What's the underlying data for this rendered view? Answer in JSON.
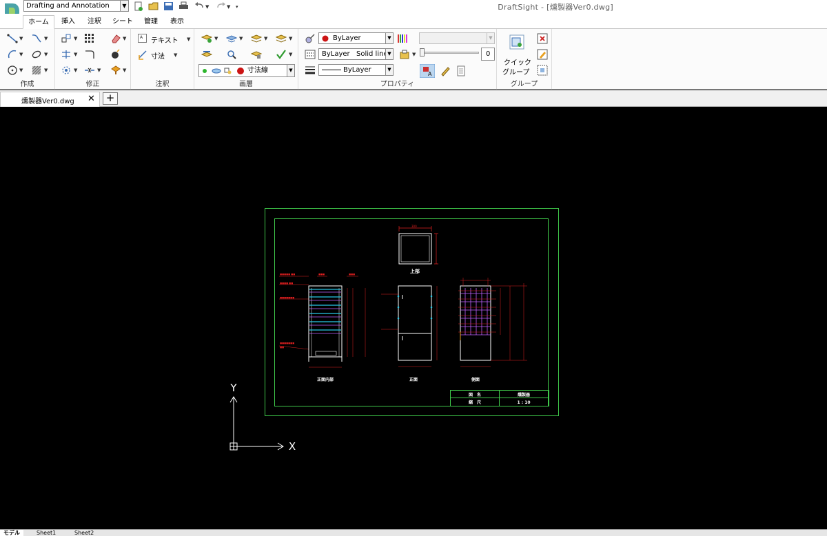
{
  "app": {
    "workspace": "Drafting and Annotation",
    "window_title": "DraftSight - [燻製器Ver0.dwg]"
  },
  "ribbon_tabs": [
    {
      "label": "ホーム",
      "active": true
    },
    {
      "label": "挿入"
    },
    {
      "label": "注釈"
    },
    {
      "label": "シート"
    },
    {
      "label": "管理"
    },
    {
      "label": "表示"
    }
  ],
  "panels": {
    "create": "作成",
    "modify": "修正",
    "annotate": "注釈",
    "layers": "画層",
    "properties": "プロパティ",
    "group": "グループ"
  },
  "annotate": {
    "text_label": "テキスト",
    "dim_label": "寸法"
  },
  "layers": {
    "current_layer": "寸法線"
  },
  "properties": {
    "color": "ByLayer",
    "linestyle_layer": "ByLayer",
    "linestyle_name": "Solid line",
    "lineweight": "ByLayer",
    "transparency": "0"
  },
  "group": {
    "quick_group_line1": "クイック",
    "quick_group_line2": "グループ"
  },
  "document": {
    "tab_label": "燻製器Ver0.dwg",
    "close_glyph": "✕",
    "new_glyph": "+"
  },
  "drawing": {
    "view_top": "上部",
    "view_front_inner": "正面内部",
    "view_front": "正面",
    "view_side": "側面",
    "titleblock_label1": "図　名",
    "titleblock_value1": "燻製器",
    "titleblock_label2": "縮　尺",
    "titleblock_value2": "1 : 10"
  },
  "ucs": {
    "x_label": "X",
    "y_label": "Y"
  },
  "sheets": [
    {
      "label": "モデル",
      "active": true
    },
    {
      "label": "Sheet1"
    },
    {
      "label": "Sheet2"
    }
  ],
  "colors": {
    "frame": "#3fc94a",
    "dimension": "#e02020",
    "shelf": "#28c8e8",
    "rack": "#c060ff",
    "outline": "#ffffff"
  }
}
